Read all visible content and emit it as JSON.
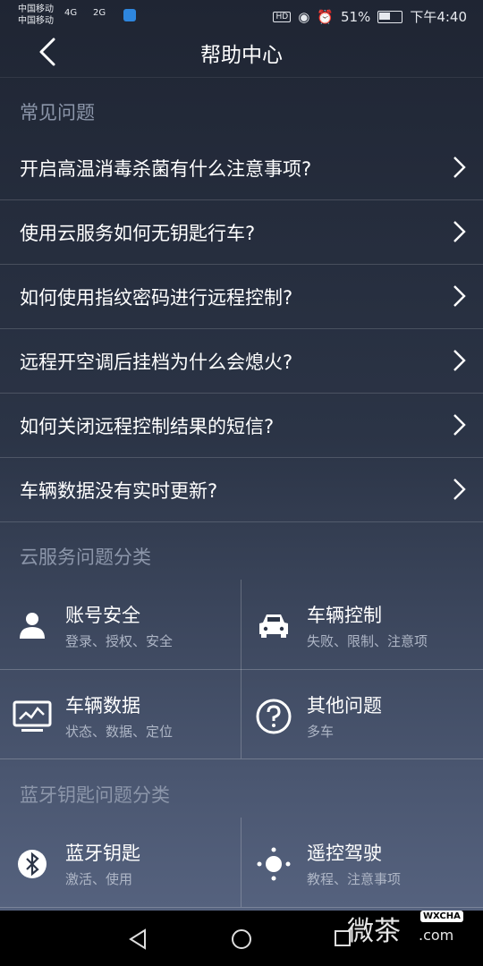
{
  "status_bar": {
    "carrier1": "中国移动",
    "carrier2": "中国移动",
    "net1": "4G",
    "net2": "2G",
    "battery": "51%",
    "time": "下午4:40"
  },
  "header": {
    "title": "帮助中心"
  },
  "faq_section": {
    "title": "常见问题",
    "items": [
      {
        "label": "开启高温消毒杀菌有什么注意事项?"
      },
      {
        "label": "使用云服务如何无钥匙行车?"
      },
      {
        "label": "如何使用指纹密码进行远程控制?"
      },
      {
        "label": "远程开空调后挂档为什么会熄火?"
      },
      {
        "label": "如何关闭远程控制结果的短信?"
      },
      {
        "label": "车辆数据没有实时更新?"
      }
    ]
  },
  "cloud_section": {
    "title": "云服务问题分类",
    "items": [
      {
        "title": "账号安全",
        "sub": "登录、授权、安全",
        "icon": "user-icon"
      },
      {
        "title": "车辆控制",
        "sub": "失败、限制、注意项",
        "icon": "car-icon"
      },
      {
        "title": "车辆数据",
        "sub": "状态、数据、定位",
        "icon": "monitor-chart-icon"
      },
      {
        "title": "其他问题",
        "sub": "多车",
        "icon": "question-icon"
      }
    ]
  },
  "bluetooth_section": {
    "title": "蓝牙钥匙问题分类",
    "items": [
      {
        "title": "蓝牙钥匙",
        "sub": "激活、使用",
        "icon": "bluetooth-icon"
      },
      {
        "title": "遥控驾驶",
        "sub": "教程、注意事项",
        "icon": "remote-drive-icon"
      }
    ]
  },
  "watermark": {
    "text": "微茶",
    "badge": "WXCHA",
    "suffix": ".com"
  }
}
